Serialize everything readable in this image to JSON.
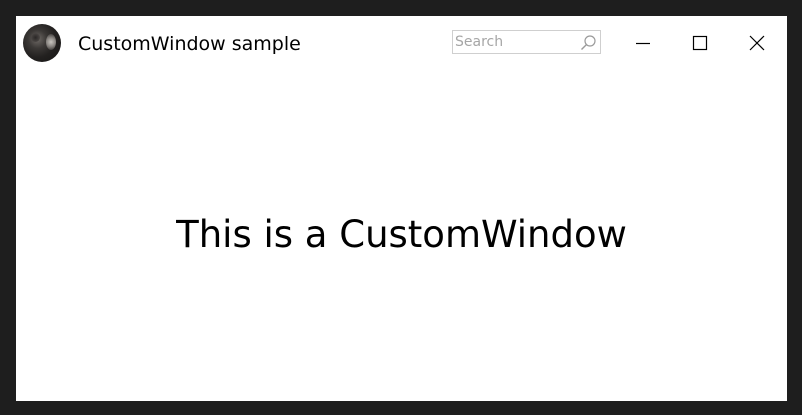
{
  "window": {
    "title": "CustomWindow sample",
    "icon": "death-star-icon"
  },
  "search": {
    "placeholder": "Search",
    "value": "",
    "icon": "search-icon"
  },
  "caption_buttons": {
    "minimize_icon": "minimize-icon",
    "maximize_icon": "maximize-icon",
    "close_icon": "close-icon"
  },
  "content": {
    "message": "This is a CustomWindow"
  },
  "colors": {
    "outer_background": "#1e1e1e",
    "window_background": "#ffffff",
    "text": "#000000",
    "placeholder": "#a6a6a6",
    "search_border": "#cfcfcf"
  }
}
